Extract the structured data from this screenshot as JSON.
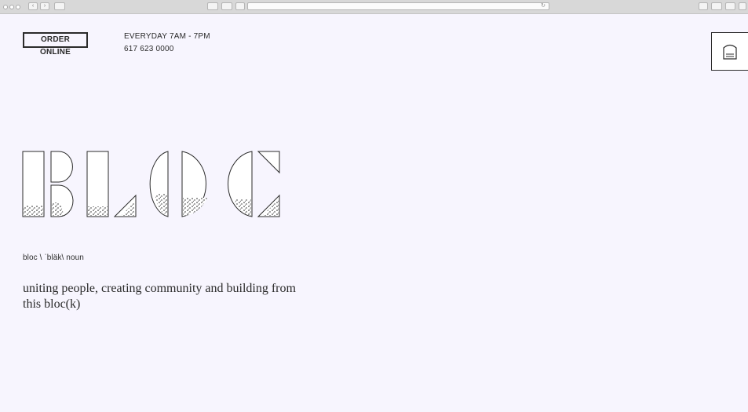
{
  "header": {
    "order_label": "ORDER ONLINE",
    "hours": "EVERYDAY 7AM - 7PM",
    "phone": "617 623 0000"
  },
  "hero": {
    "logo_text": "BLOC"
  },
  "definition": {
    "pronunciation": "bloc \\ ˈbläk\\ noun",
    "tagline": "uniting people, creating community and building from this bloc(k)"
  },
  "colors": {
    "background": "#f7f5fe",
    "ink": "#2b2b2b"
  }
}
